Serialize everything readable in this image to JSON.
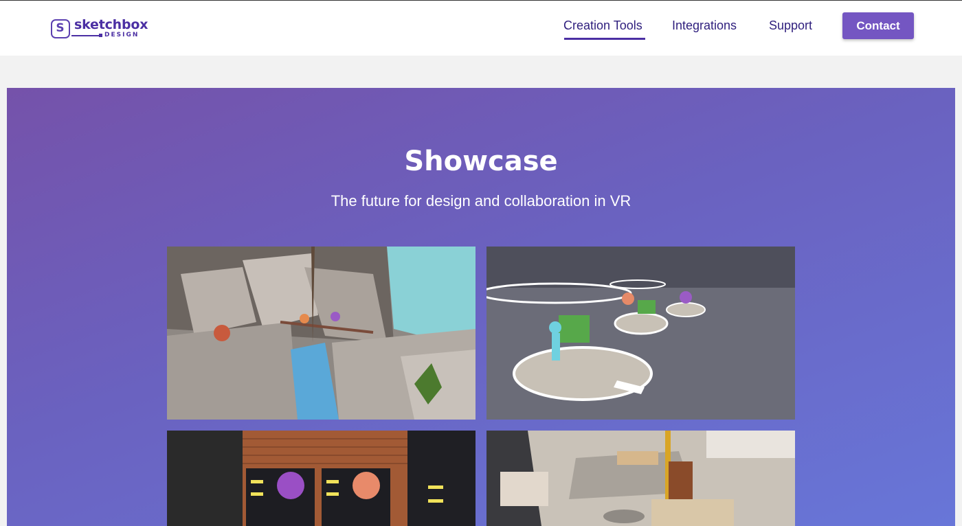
{
  "brand": {
    "name": "sketchbox",
    "sub": "DESIGN",
    "mark": "S"
  },
  "nav": {
    "items": [
      {
        "label": "Creation Tools",
        "active": true
      },
      {
        "label": "Integrations",
        "active": false
      },
      {
        "label": "Support",
        "active": false
      }
    ],
    "contact_label": "Contact"
  },
  "showcase": {
    "title": "Showcase",
    "subtitle": "The future for design and collaboration in VR"
  },
  "colors": {
    "brand": "#4b2fa3",
    "button": "#7456c2",
    "gradient_start": "#7552aa",
    "gradient_end": "#6876d8"
  }
}
